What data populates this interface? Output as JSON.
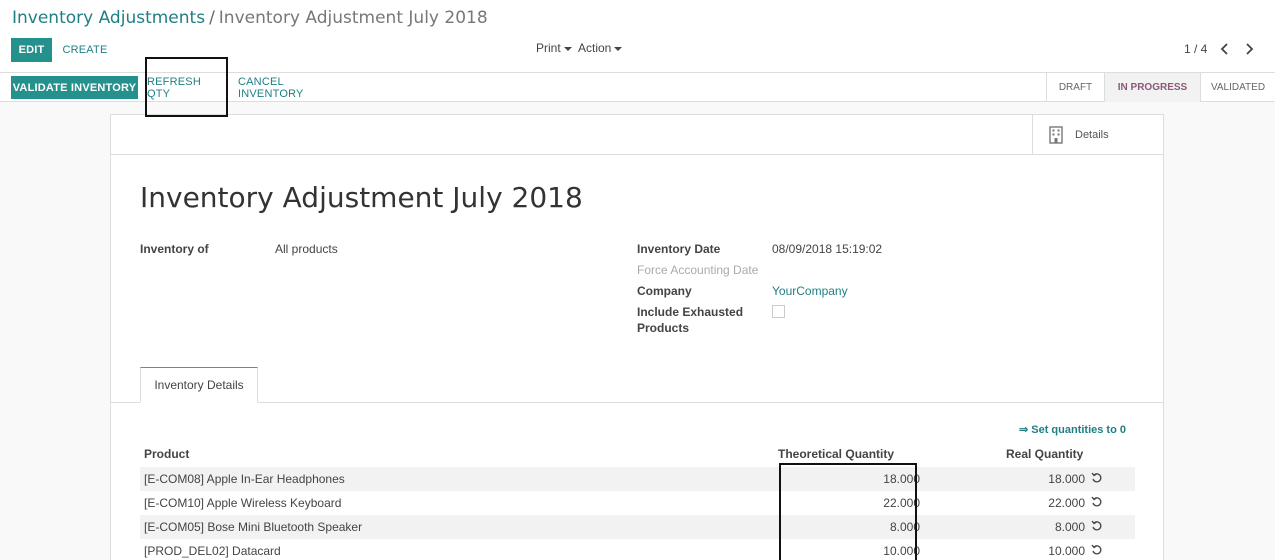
{
  "breadcrumb": {
    "parent": "Inventory Adjustments",
    "separator": "/",
    "current": "Inventory Adjustment July 2018"
  },
  "toolbar": {
    "edit_label": "EDIT",
    "create_label": "CREATE",
    "print_label": "Print",
    "action_label": "Action",
    "pager": "1 / 4"
  },
  "statusbar": {
    "validate_label": "VALIDATE INVENTORY",
    "refresh_label": "REFRESH QTY",
    "cancel_label": "CANCEL INVENTORY",
    "stages": [
      "DRAFT",
      "IN PROGRESS",
      "VALIDATED"
    ],
    "active_stage": "IN PROGRESS"
  },
  "sheet": {
    "details_label": "Details",
    "title": "Inventory Adjustment July 2018",
    "fields": {
      "inventory_of_label": "Inventory of",
      "inventory_of_value": "All products",
      "inventory_date_label": "Inventory Date",
      "inventory_date_value": "08/09/2018 15:19:02",
      "force_date_label": "Force Accounting Date",
      "company_label": "Company",
      "company_value": "YourCompany",
      "exhausted_label_1": "Include Exhausted",
      "exhausted_label_2": "Products"
    },
    "tab_label": "Inventory Details",
    "set_quantities_label": "⇒ Set quantities to 0"
  },
  "table": {
    "headers": {
      "product": "Product",
      "theoretical": "Theoretical Quantity",
      "real": "Real Quantity"
    },
    "rows": [
      {
        "product": "[E-COM08] Apple In-Ear Headphones",
        "theoretical": "18.000",
        "real": "18.000"
      },
      {
        "product": "[E-COM10] Apple Wireless Keyboard",
        "theoretical": "22.000",
        "real": "22.000"
      },
      {
        "product": "[E-COM05] Bose Mini Bluetooth Speaker",
        "theoretical": "8.000",
        "real": "8.000"
      },
      {
        "product": "[PROD_DEL02] Datacard",
        "theoretical": "10.000",
        "real": "10.000"
      }
    ]
  },
  "colors": {
    "primary": "#24918c",
    "link": "#1f7f84",
    "active_stage": "#875a7b"
  }
}
